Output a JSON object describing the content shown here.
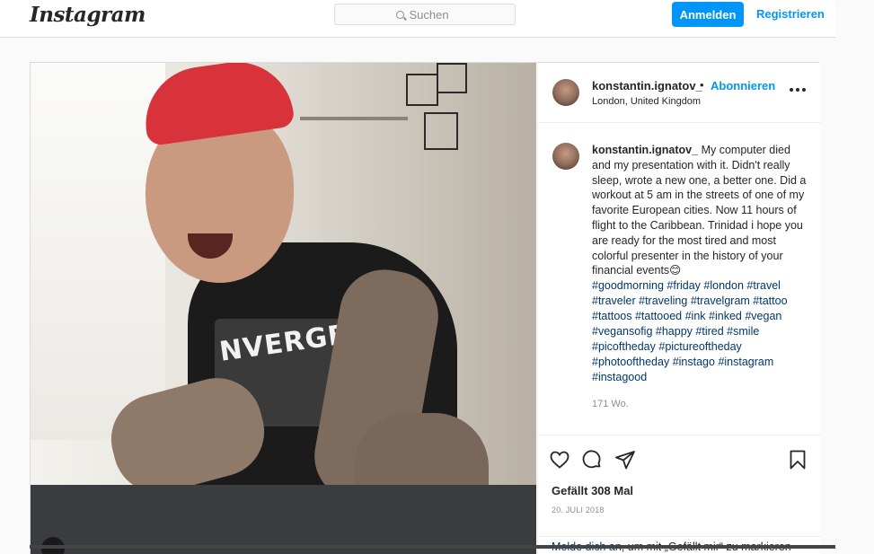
{
  "header": {
    "logo": "Instagram",
    "search_placeholder": "Suchen",
    "login_label": "Anmelden",
    "register_label": "Registrieren"
  },
  "post": {
    "username": "konstantin.ignatov_",
    "separator": "•",
    "follow_label": "Abonnieren",
    "location": "London, United Kingdom",
    "photo_print_text": "NVERGE",
    "caption": {
      "username": "konstantin.ignatov_",
      "text": "My computer died and my presentation with it. Didn't really sleep, wrote a new one, a better one. Did a workout at 5 am in the streets of one of my favorite European cities. Now 11 hours of flight to the Caribbean. Trinidad i hope you are ready for the most tired and most colorful presenter in the history of your financial events😊",
      "hashtags": [
        "#goodmorning",
        "#friday",
        "#london",
        "#travel",
        "#traveler",
        "#traveling",
        "#travelgram",
        "#tattoo",
        "#tattoos",
        "#tattooed",
        "#ink",
        "#inked",
        "#vegan",
        "#vegansofig",
        "#happy",
        "#tired",
        "#smile",
        "#picoftheday",
        "#pictureoftheday",
        "#photooftheday",
        "#instago",
        "#instagram",
        "#instagood"
      ],
      "time": "171 Wo."
    },
    "likes": "Gefällt 308 Mal",
    "date": "20. JULI 2018",
    "login_prompt": {
      "link": "Melde dich an",
      "text": ", um mit „Gefällt mir“ zu markieren"
    }
  },
  "colors": {
    "accent": "#0095f6",
    "hashtag": "#00376b",
    "border": "#dbdbdb",
    "background": "#fafafa"
  },
  "icons": [
    "search-icon",
    "more-options-icon",
    "heart-icon",
    "comment-icon",
    "share-icon",
    "bookmark-icon"
  ]
}
